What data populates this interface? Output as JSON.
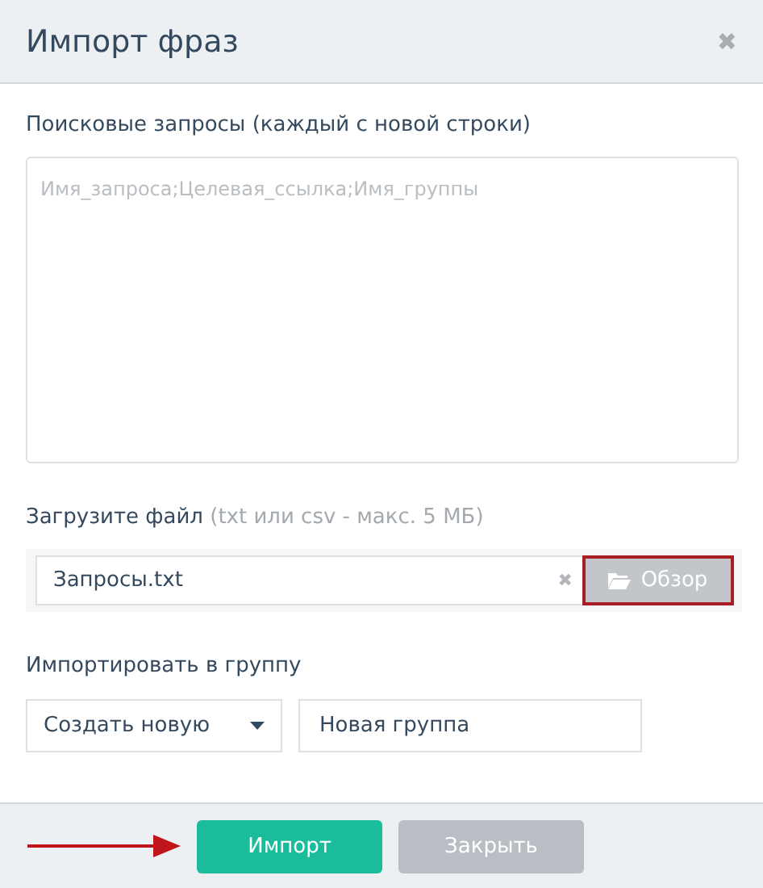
{
  "dialog": {
    "title": "Импорт фраз",
    "close_icon": "✖"
  },
  "queries": {
    "label": "Поисковые запросы (каждый с новой строки)",
    "placeholder": "Имя_запроса;Целевая_ссылка;Имя_группы"
  },
  "file_upload": {
    "label": "Загрузите файл",
    "hint": "(txt или csv - макс. 5 МБ)",
    "value": "Запросы.txt",
    "clear_icon": "✖",
    "browse_button": {
      "label": "Обзор",
      "highlighted": true
    }
  },
  "group": {
    "label": "Импортировать в группу",
    "select_value": "Создать новую",
    "name_value": "Новая группа"
  },
  "footer": {
    "pointer_arrow": true,
    "buttons": [
      {
        "label": "Импорт",
        "kind": "primary"
      },
      {
        "label": "Закрыть",
        "kind": "secondary"
      }
    ]
  }
}
